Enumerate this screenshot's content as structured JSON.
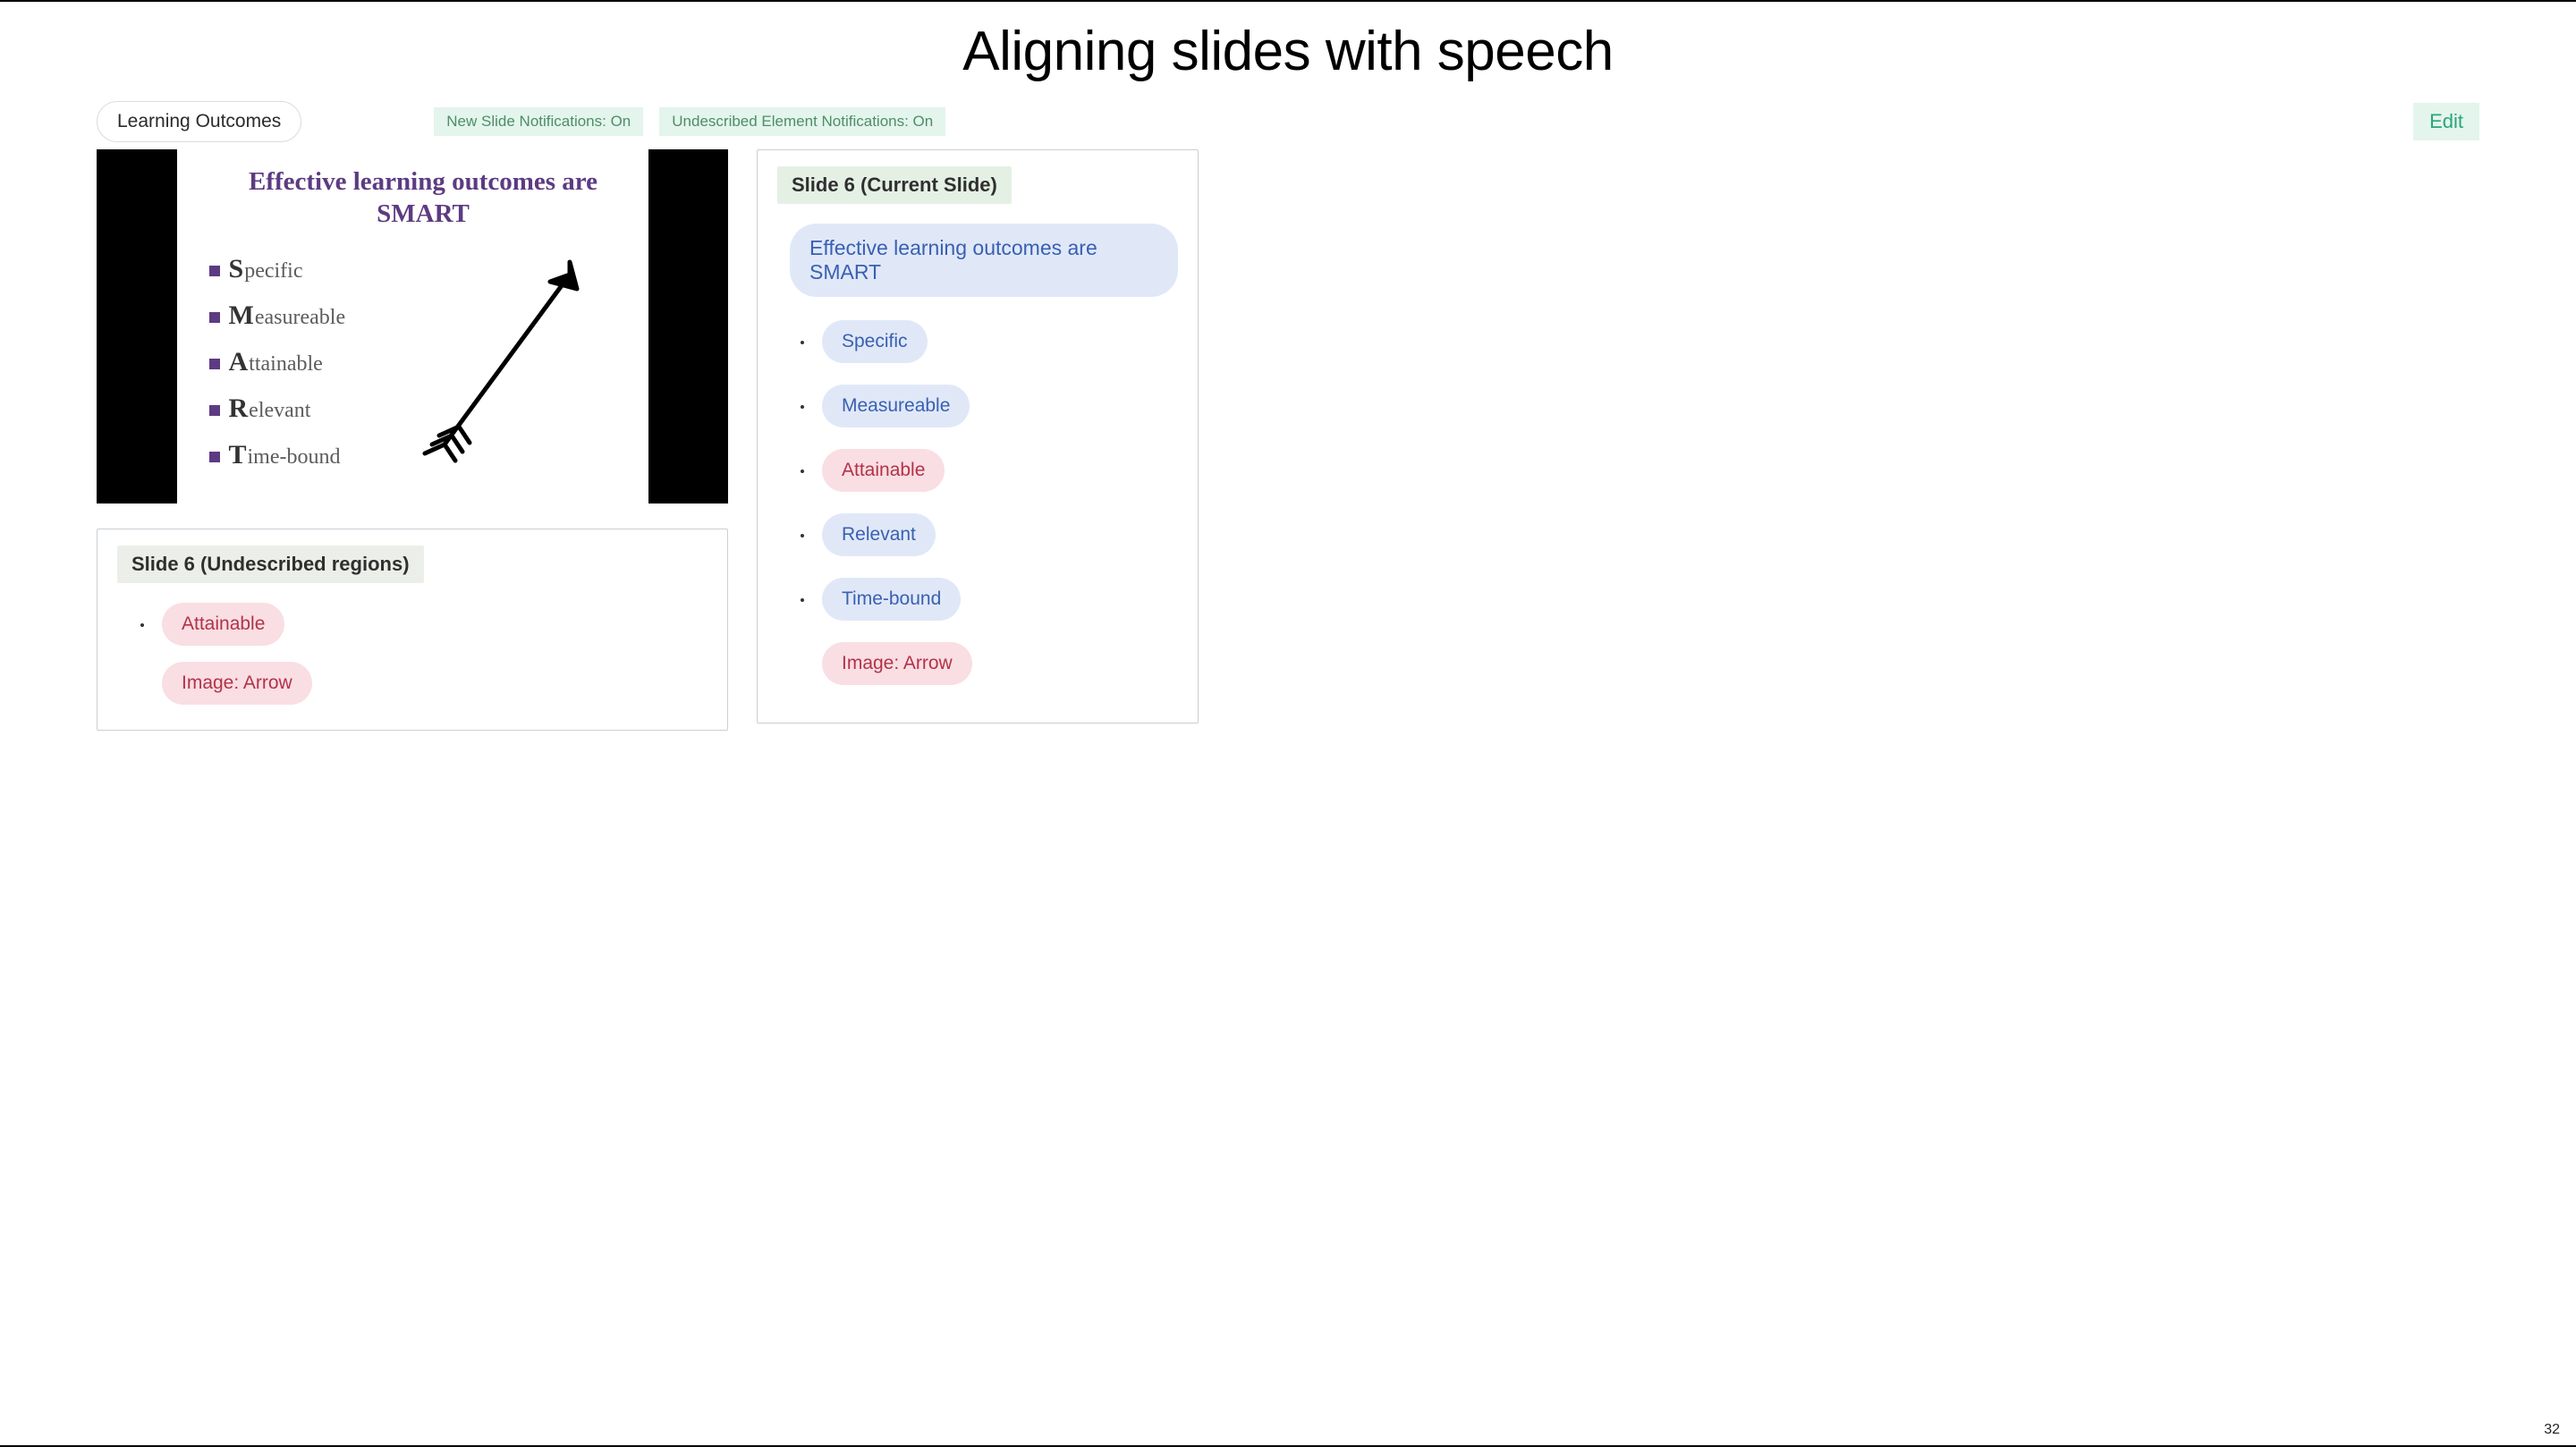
{
  "page_title": "Aligning slides with speech",
  "toolbar": {
    "breadcrumb": "Learning Outcomes",
    "new_slide_notif": "New Slide Notifications: On",
    "undescribed_notif": "Undescribed Element Notifications: On",
    "edit_label": "Edit"
  },
  "slide_preview": {
    "heading": "Effective learning outcomes are SMART",
    "items": [
      {
        "big": "S",
        "rest": "pecific"
      },
      {
        "big": "M",
        "rest": "easureable"
      },
      {
        "big": "A",
        "rest": "ttainable"
      },
      {
        "big": "R",
        "rest": "elevant"
      },
      {
        "big": "T",
        "rest": "ime-bound"
      }
    ],
    "image_alt": "Arrow"
  },
  "undescribed_panel": {
    "header": "Slide 6 (Undescribed regions)",
    "items": [
      {
        "label": "Attainable",
        "kind": "red"
      }
    ],
    "extra": {
      "label": "Image: Arrow",
      "kind": "red"
    }
  },
  "current_panel": {
    "header": "Slide 6 (Current Slide)",
    "title_pill": "Effective learning outcomes are SMART",
    "items": [
      {
        "label": "Specific",
        "kind": "blue"
      },
      {
        "label": "Measureable",
        "kind": "blue"
      },
      {
        "label": "Attainable",
        "kind": "red"
      },
      {
        "label": "Relevant",
        "kind": "blue"
      },
      {
        "label": "Time-bound",
        "kind": "blue"
      }
    ],
    "extra": {
      "label": "Image: Arrow",
      "kind": "red"
    }
  },
  "page_number": "32"
}
